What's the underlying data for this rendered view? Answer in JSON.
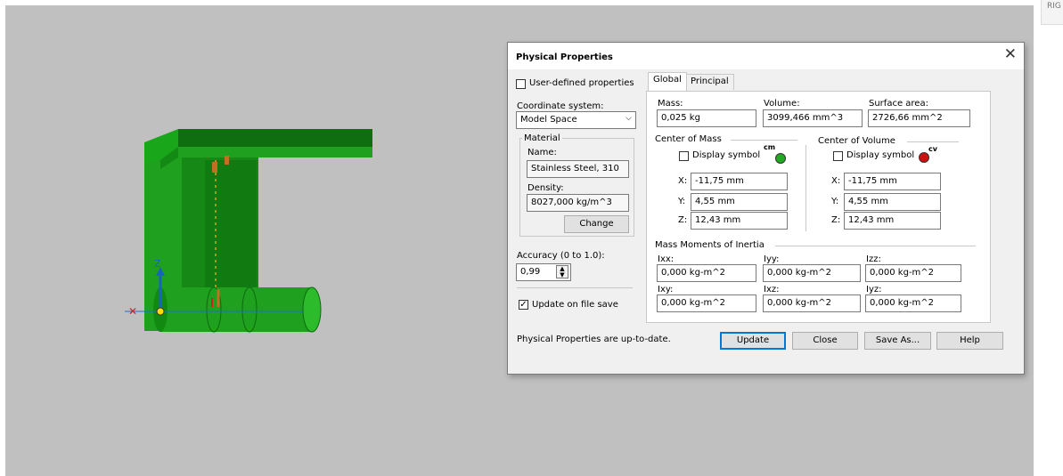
{
  "corner_tab": "RIG",
  "dialog": {
    "title": "Physical Properties",
    "close_glyph": "✕",
    "user_defined_label": "User-defined properties",
    "coord_label": "Coordinate system:",
    "coord_value": "Model Space",
    "material": {
      "group_label": "Material",
      "name_label": "Name:",
      "name_value": "Stainless Steel, 310",
      "density_label": "Density:",
      "density_value": "8027,000 kg/m^3",
      "change_label": "Change"
    },
    "accuracy_label": "Accuracy (0 to 1.0):",
    "accuracy_value": "0,99",
    "update_on_save_label": "Update on file save",
    "update_on_save_checked": true,
    "tabs": [
      "Global",
      "Principal"
    ],
    "active_tab": "Global",
    "mass_label": "Mass:",
    "mass_value": "0,025 kg",
    "volume_label": "Volume:",
    "volume_value": "3099,466 mm^3",
    "surface_label": "Surface area:",
    "surface_value": "2726,66 mm^2",
    "com": {
      "group_label": "Center of Mass",
      "display_label": "Display symbol",
      "symbol_text": "cm",
      "symbol_color": "#22aa22",
      "x_label": "X:",
      "x_value": "-11,75 mm",
      "y_label": "Y:",
      "y_value": "4,55 mm",
      "z_label": "Z:",
      "z_value": "12,43 mm"
    },
    "cov": {
      "group_label": "Center of Volume",
      "display_label": "Display symbol",
      "symbol_text": "cv",
      "symbol_color": "#cc1111",
      "x_label": "X:",
      "x_value": "-11,75 mm",
      "y_label": "Y:",
      "y_value": "4,55 mm",
      "z_label": "Z:",
      "z_value": "12,43 mm"
    },
    "inertia": {
      "group_label": "Mass Moments of Inertia",
      "ixx_label": "Ixx:",
      "ixx_value": "0,000 kg-m^2",
      "iyy_label": "Iyy:",
      "iyy_value": "0,000 kg-m^2",
      "izz_label": "Izz:",
      "izz_value": "0,000 kg-m^2",
      "ixy_label": "Ixy:",
      "ixy_value": "0,000 kg-m^2",
      "ixz_label": "Ixz:",
      "ixz_value": "0,000 kg-m^2",
      "iyz_label": "Iyz:",
      "iyz_value": "0,000 kg-m^2"
    },
    "status": "Physical Properties are up-to-date.",
    "buttons": {
      "update": "Update",
      "close": "Close",
      "save_as": "Save As...",
      "help": "Help"
    }
  },
  "axis": {
    "z_label": "Z"
  },
  "colors": {
    "part_green": "#1fa01f",
    "part_dark": "#0d6b0d",
    "accent": "#0078d7",
    "viewport_bg": "#c0c0c0"
  }
}
